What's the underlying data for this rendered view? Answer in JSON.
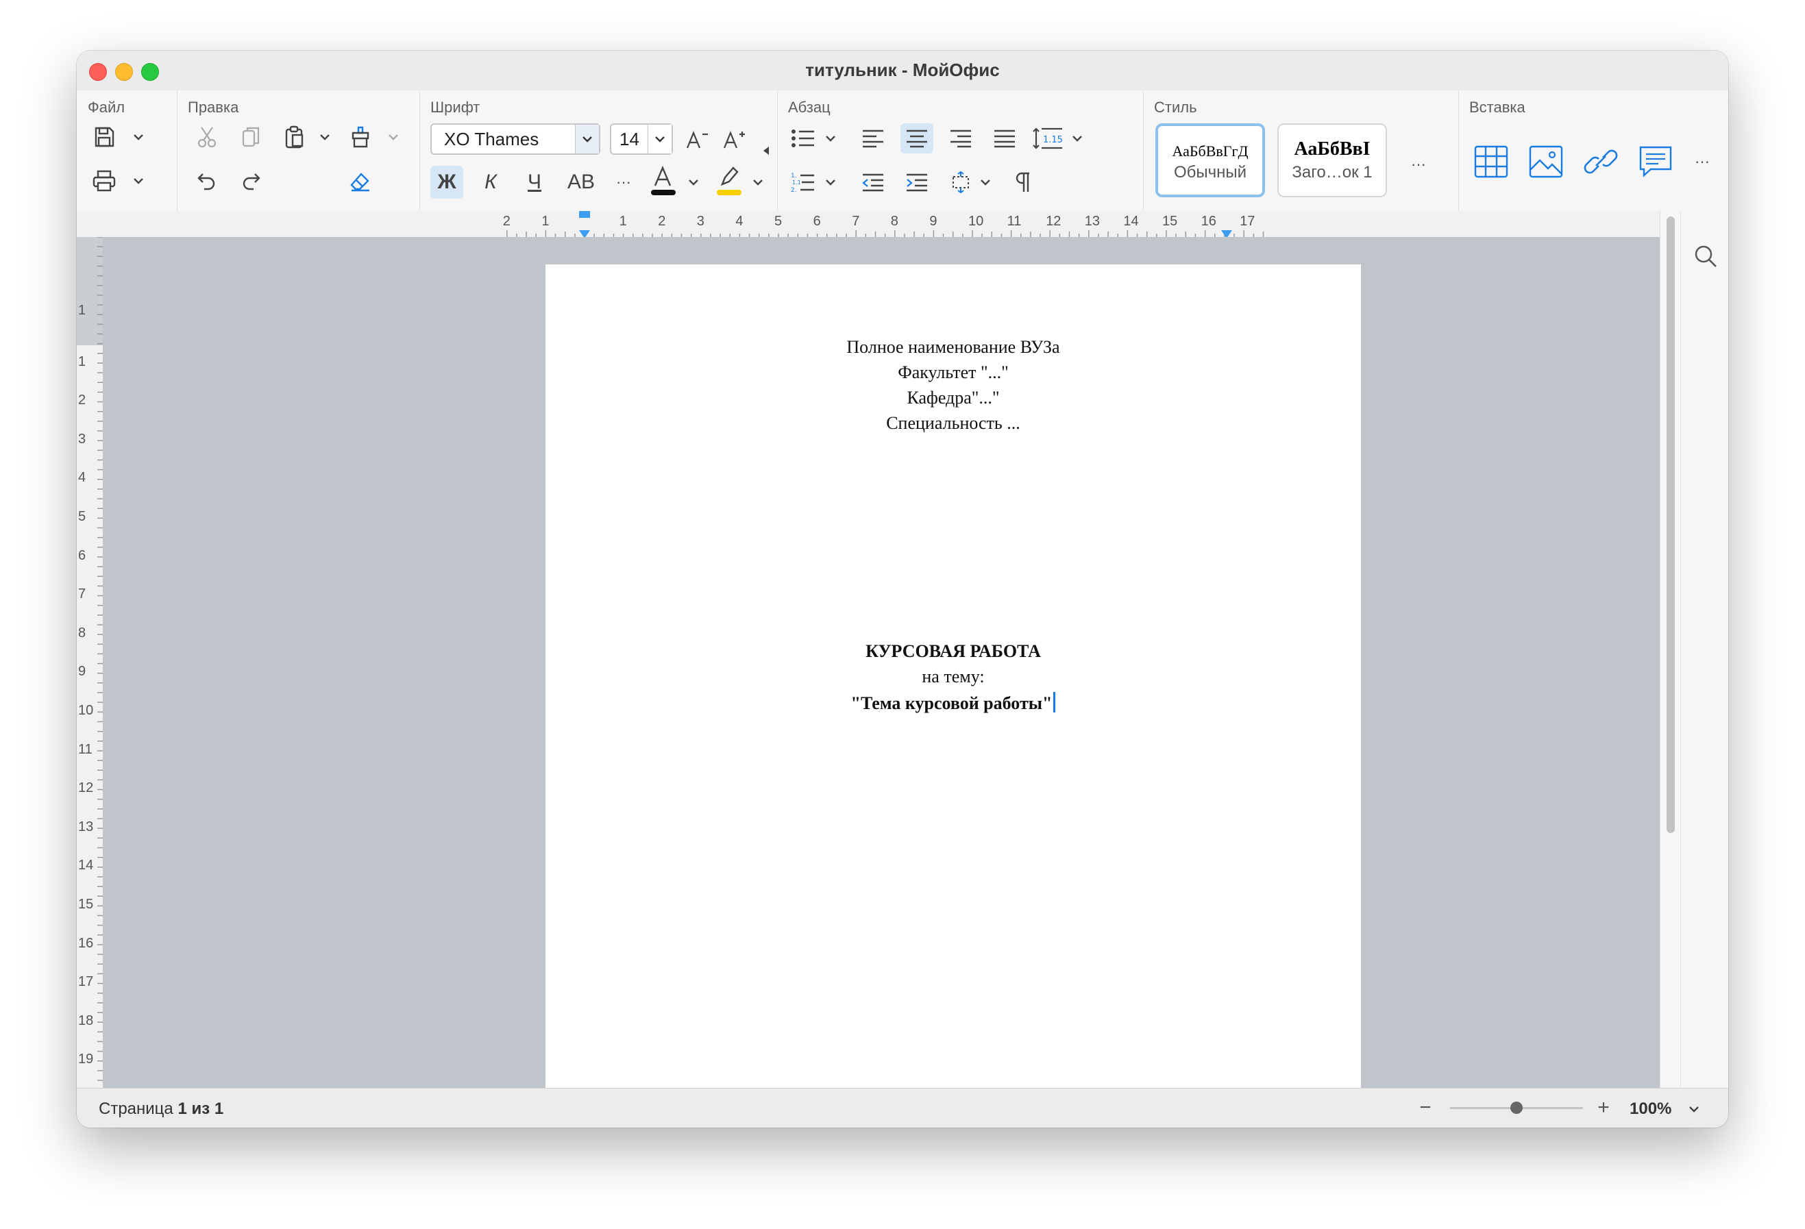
{
  "window": {
    "title": "титульник - МойОфис"
  },
  "ribbon": {
    "groups": {
      "file": "Файл",
      "edit": "Правка",
      "font": "Шрифт",
      "paragraph": "Абзац",
      "style": "Стиль",
      "insert": "Вставка"
    },
    "font_name": "XO Thames",
    "font_size": "14",
    "bold_label": "Ж",
    "italic_label": "К",
    "underline_label": "Ч",
    "strike_label": "АВ",
    "more_label": "···",
    "line_spacing": "1.15",
    "styles": [
      {
        "sample": "АаБбВвГгД",
        "name": "Обычный"
      },
      {
        "sample": "АаБбВвI",
        "name": "Заго…ок 1"
      }
    ]
  },
  "ruler": {
    "horizontal": [
      "2",
      "1",
      "1",
      "2",
      "3",
      "4",
      "5",
      "6",
      "7",
      "8",
      "9",
      "10",
      "11",
      "12",
      "13",
      "14",
      "15",
      "16",
      "17"
    ],
    "vertical": [
      "1",
      "1",
      "2",
      "3",
      "4",
      "5",
      "6",
      "7",
      "8",
      "9",
      "10",
      "11",
      "12",
      "13",
      "14",
      "15",
      "16",
      "17",
      "18",
      "19"
    ]
  },
  "document": {
    "header_lines": [
      "Полное наименование ВУЗа",
      "Факультет \"...\"",
      "Кафедра\"...\"",
      "Специальность ..."
    ],
    "title": "КУРСОВАЯ РАБОТА",
    "subtitle": "на тему:",
    "topic": "\"Тема курсовой работы\""
  },
  "status": {
    "page_prefix": "Страница ",
    "page_current": "1",
    "page_middle": " из ",
    "page_total": "1",
    "zoom_minus": "−",
    "zoom_plus": "+",
    "zoom_level": "100%",
    "zoom_fraction": 0.5
  },
  "colors": {
    "accent": "#1a7be0",
    "font_color_bar": "#111111",
    "highlight_bar": "#f5d000"
  }
}
